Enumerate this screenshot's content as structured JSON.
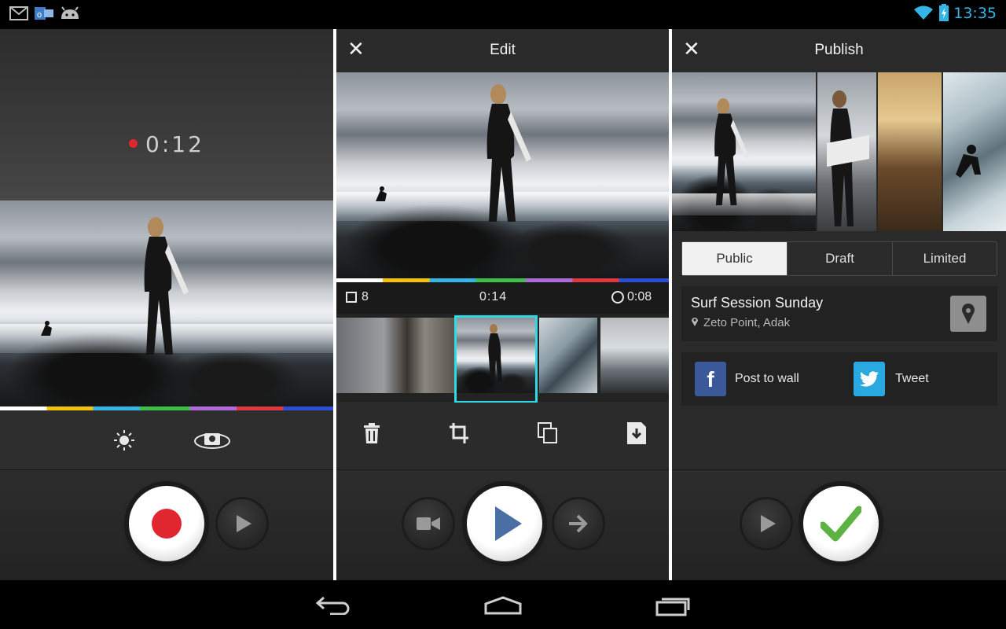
{
  "status_bar": {
    "time": "13:35",
    "left_icons": [
      "gmail-icon",
      "outlook-icon",
      "android-icon"
    ],
    "right_icons": [
      "wifi-icon",
      "battery-icon"
    ]
  },
  "record": {
    "timer": "0:12",
    "tools": [
      "brightness-icon",
      "switch-camera-icon"
    ],
    "controls": [
      "record-button",
      "play-button"
    ]
  },
  "edit": {
    "title": "Edit",
    "clip_count": "8",
    "position": "0:14",
    "clip_duration": "0:08",
    "tools": [
      "delete-icon",
      "crop-icon",
      "duplicate-icon",
      "save-icon"
    ],
    "controls": [
      "camera-button",
      "play-button",
      "next-button"
    ]
  },
  "publish": {
    "title": "Publish",
    "privacy_tabs": [
      "Public",
      "Draft",
      "Limited"
    ],
    "selected_privacy": "Public",
    "video_title": "Surf Session Sunday",
    "location": "Zeto Point, Adak",
    "share": {
      "facebook_label": "Post to wall",
      "twitter_label": "Tweet"
    },
    "controls": [
      "play-button",
      "confirm-button"
    ]
  },
  "colors": {
    "accent": "#33b5e5",
    "record_red": "#e0262e",
    "play_blue": "#4a6fa5",
    "confirm_green": "#5cb344",
    "selection_cyan": "#33d8e5",
    "facebook": "#3b5998",
    "twitter": "#2aa9e0"
  }
}
